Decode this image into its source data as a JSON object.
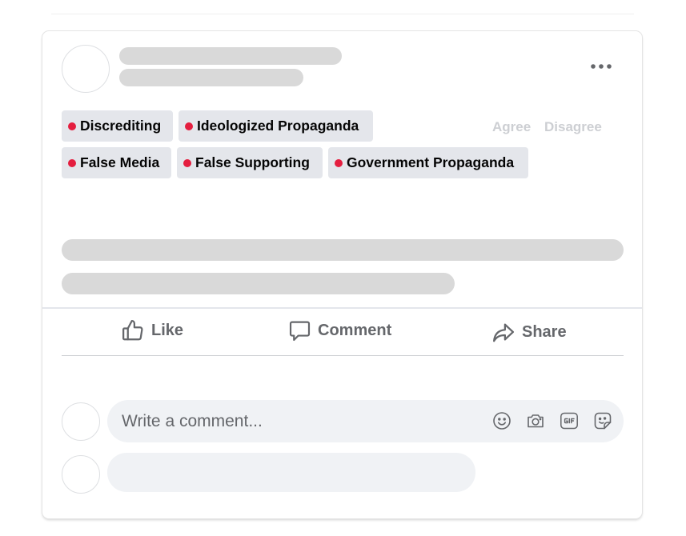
{
  "post": {
    "more_menu_icon": "ellipsis-horizontal-icon",
    "tags": [
      {
        "label": "Discrediting",
        "dot_color": "#e41e3f"
      },
      {
        "label": "Ideologized Propaganda",
        "dot_color": "#e41e3f"
      },
      {
        "label": "False Media",
        "dot_color": "#e41e3f"
      },
      {
        "label": "False Supporting",
        "dot_color": "#e41e3f"
      },
      {
        "label": "Government Propaganda",
        "dot_color": "#e41e3f"
      }
    ],
    "vote": {
      "agree_label": "Agree",
      "disagree_label": "Disagree"
    }
  },
  "actions": {
    "like_label": "Like",
    "comment_label": "Comment",
    "share_label": "Share"
  },
  "comment_input": {
    "placeholder": "Write a comment...",
    "icons": [
      "smiley-icon",
      "camera-icon",
      "gif-icon",
      "sticker-icon"
    ]
  },
  "colors": {
    "tag_bg": "#e4e6eb",
    "skeleton": "#d9d9d9",
    "action_text": "#65676b",
    "vote_text": "#cdcfd3"
  }
}
